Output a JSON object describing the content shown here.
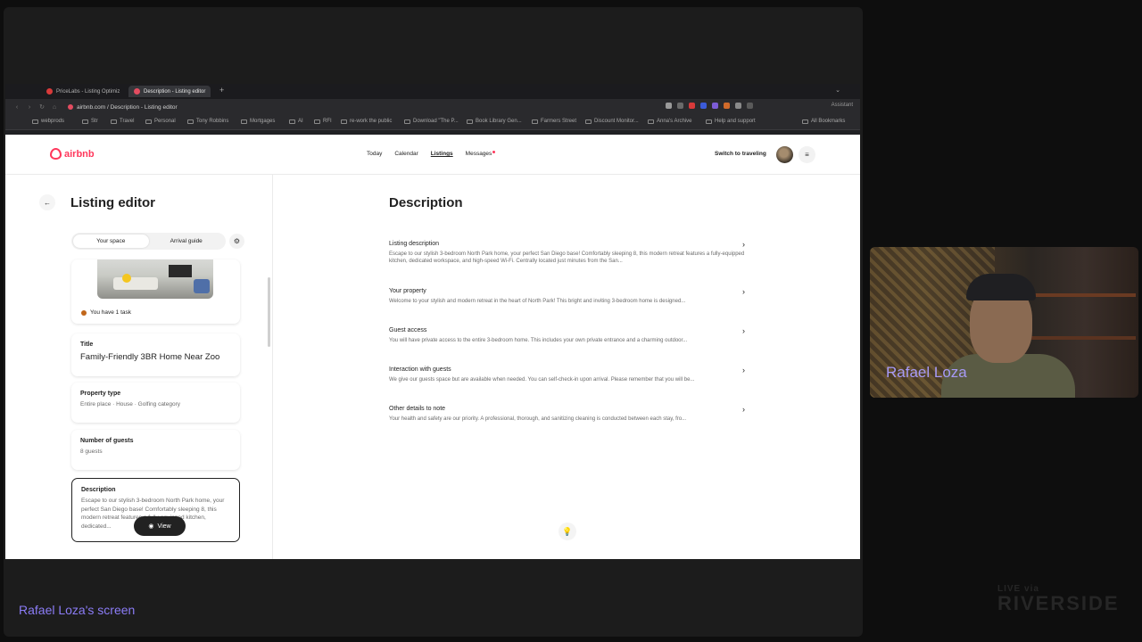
{
  "browser": {
    "tabs": [
      {
        "label": "PriceLabs - Listing Optimiz",
        "active": false
      },
      {
        "label": "Description - Listing editor",
        "active": true
      }
    ],
    "url": "airbnb.com / Description - Listing editor",
    "assistant_label": "Assistant",
    "bookmarks": [
      "webprods",
      "Str",
      "Travel",
      "Personal",
      "Tony Robbins",
      "Mortgages",
      "AI",
      "RFI",
      "re-work the public",
      "Download \"The P...",
      "Book Library Gen...",
      "Farmers Street",
      "Discount Monitor...",
      "Anna's Archive",
      "Help and support",
      "All Bookmarks"
    ]
  },
  "airbnb": {
    "logo_text": "airbnb",
    "nav": {
      "today": "Today",
      "calendar": "Calendar",
      "listings": "Listings",
      "messages": "Messages"
    },
    "switch_label": "Switch to traveling",
    "left": {
      "title": "Listing editor",
      "toggle": {
        "your_space": "Your space",
        "arrival_guide": "Arrival guide"
      },
      "task_text": "You have 1 task",
      "cards": {
        "title": {
          "label": "Title",
          "value": "Family-Friendly 3BR Home Near Zoo"
        },
        "property_type": {
          "label": "Property type",
          "value": "Entire place · House · Golfing category"
        },
        "guests": {
          "label": "Number of guests",
          "value": "8 guests"
        },
        "description": {
          "label": "Description",
          "value": "Escape to our stylish 3-bedroom North Park home, your perfect San Diego base! Comfortably sleeping 8, this modern retreat features a fully-equipped kitchen, dedicated..."
        }
      },
      "view_button": "View"
    },
    "right": {
      "heading": "Description",
      "rows": [
        {
          "label": "Listing description",
          "text": "Escape to our stylish 3-bedroom North Park home, your perfect San Diego base! Comfortably sleeping 8, this modern retreat features a fully-equipped kitchen, dedicated workspace, and high-speed Wi-Fi. Centrally located just minutes from the San..."
        },
        {
          "label": "Your property",
          "text": "Welcome to your stylish and modern retreat in the heart of North Park! This bright and inviting 3-bedroom home is designed..."
        },
        {
          "label": "Guest access",
          "text": "You will have private access to the entire 3-bedroom home. This includes your own private entrance and a charming outdoor..."
        },
        {
          "label": "Interaction with guests",
          "text": "We give our guests space but are available when needed. You can self-check-in upon arrival. Please remember that you will be..."
        },
        {
          "label": "Other details to note",
          "text": "Your health and safety are our priority. A professional, thorough, and sanitizing cleaning is conducted between each stay, fro..."
        }
      ]
    }
  },
  "webcam": {
    "name": "Rafael Loza"
  },
  "screen_caption": "Rafael Loza's screen",
  "watermark": {
    "top": "LIVE via",
    "bottom": "RIVERSIDE"
  },
  "colors": {
    "brand": "#ff385c",
    "caption": "#8b7cf6",
    "task_dot": "#c1661a"
  }
}
